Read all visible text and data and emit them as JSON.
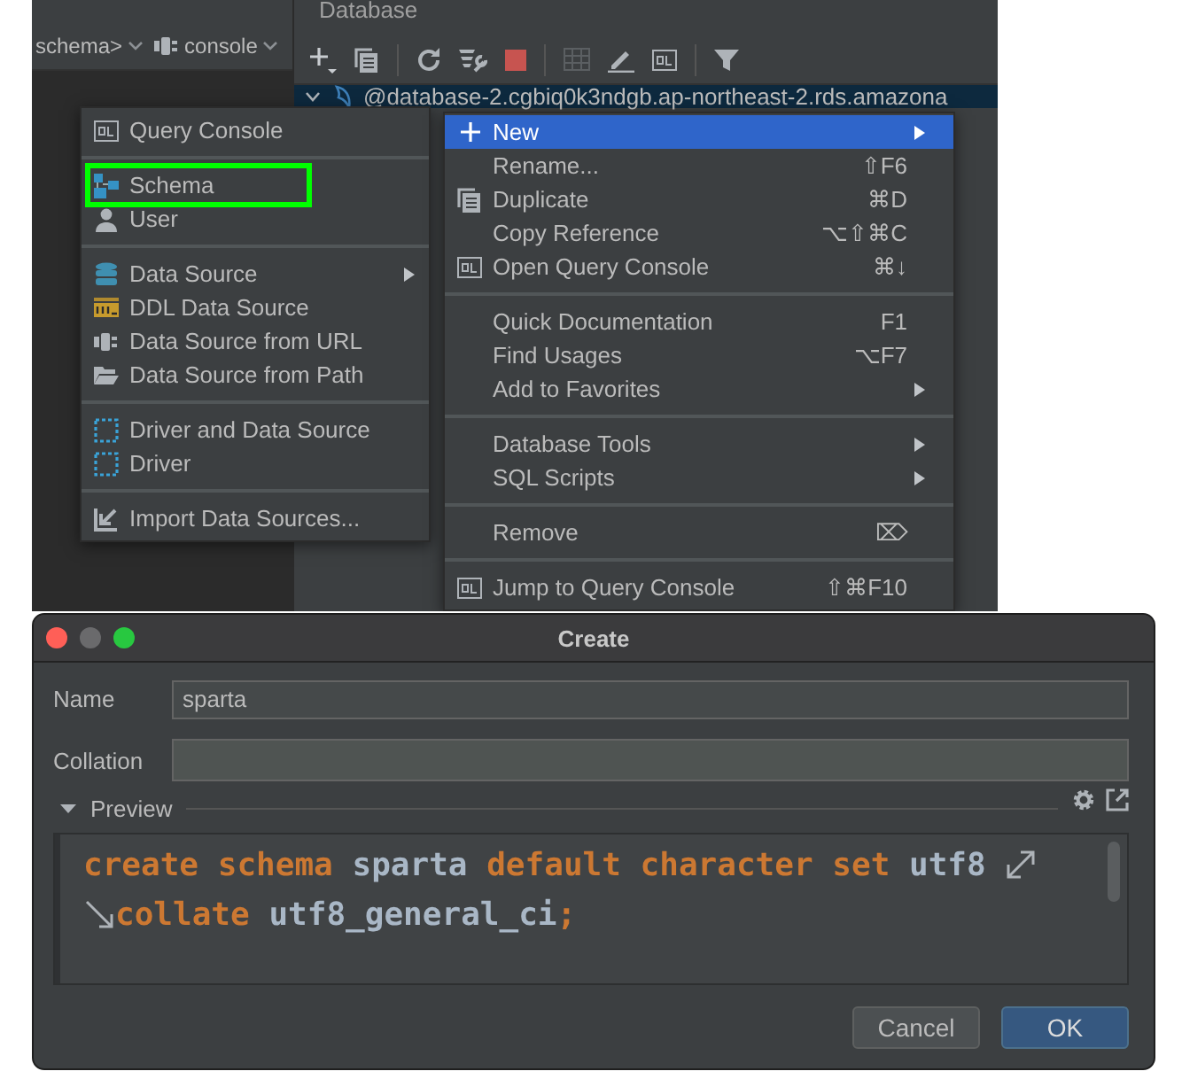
{
  "editor_toolbar": {
    "breadcrumb": "schema>",
    "console": "console"
  },
  "database_panel": {
    "title": "Database",
    "tree": [
      {
        "label": "@database-2.cgbiq0k3ndgb.ap-northeast-2.rds.amazona",
        "expanded": true,
        "selected": true
      }
    ]
  },
  "new_menu": {
    "items": [
      {
        "kind": "item",
        "label": "Query Console",
        "highlighted": false,
        "submenu": false
      },
      {
        "kind": "separator"
      },
      {
        "kind": "item",
        "label": "Schema",
        "highlighted": true,
        "submenu": false
      },
      {
        "kind": "item",
        "label": "User",
        "highlighted": false,
        "submenu": false
      },
      {
        "kind": "separator"
      },
      {
        "kind": "item",
        "label": "Data Source",
        "highlighted": false,
        "submenu": true
      },
      {
        "kind": "item",
        "label": "DDL Data Source",
        "highlighted": false,
        "submenu": false
      },
      {
        "kind": "item",
        "label": "Data Source from URL",
        "highlighted": false,
        "submenu": false
      },
      {
        "kind": "item",
        "label": "Data Source from Path",
        "highlighted": false,
        "submenu": false
      },
      {
        "kind": "separator"
      },
      {
        "kind": "item",
        "label": "Driver and Data Source",
        "highlighted": false,
        "submenu": false
      },
      {
        "kind": "item",
        "label": "Driver",
        "highlighted": false,
        "submenu": false
      },
      {
        "kind": "separator"
      },
      {
        "kind": "item",
        "label": "Import Data Sources...",
        "highlighted": false,
        "submenu": false
      }
    ]
  },
  "context_menu": {
    "items": [
      {
        "kind": "item",
        "label": "New",
        "selected": true,
        "submenu": true
      },
      {
        "kind": "item",
        "label": "Rename...",
        "selected": false,
        "shortcut": "⇧F6",
        "submenu": false
      },
      {
        "kind": "item",
        "label": "Duplicate",
        "selected": false,
        "shortcut": "⌘D",
        "submenu": false
      },
      {
        "kind": "item",
        "label": "Copy Reference",
        "selected": false,
        "shortcut": "⌥⇧⌘C",
        "submenu": false
      },
      {
        "kind": "item",
        "label": "Open Query Console",
        "selected": false,
        "shortcut": "⌘↓",
        "submenu": false
      },
      {
        "kind": "separator"
      },
      {
        "kind": "item",
        "label": "Quick Documentation",
        "selected": false,
        "shortcut": "F1",
        "submenu": false
      },
      {
        "kind": "item",
        "label": "Find Usages",
        "selected": false,
        "shortcut": "⌥F7",
        "submenu": false
      },
      {
        "kind": "item",
        "label": "Add to Favorites",
        "selected": false,
        "submenu": true
      },
      {
        "kind": "separator"
      },
      {
        "kind": "item",
        "label": "Database Tools",
        "selected": false,
        "submenu": true
      },
      {
        "kind": "item",
        "label": "SQL Scripts",
        "selected": false,
        "submenu": true
      },
      {
        "kind": "separator"
      },
      {
        "kind": "item",
        "label": "Remove",
        "selected": false,
        "shortcut": "⌦",
        "submenu": false
      },
      {
        "kind": "separator"
      },
      {
        "kind": "item",
        "label": "Jump to Query Console",
        "selected": false,
        "shortcut": "⇧⌘F10",
        "submenu": false
      }
    ]
  },
  "dialog": {
    "title": "Create",
    "fields": [
      {
        "label": "Name",
        "value": "sparta"
      },
      {
        "label": "Collation"
      }
    ],
    "preview": {
      "label": "Preview",
      "expanded": true,
      "lines": [
        {
          "wrapped": true,
          "continued": false,
          "tokens": [
            {
              "kind": "keyword",
              "text": "create schema"
            },
            {
              "kind": "plain",
              "text": " sparta "
            },
            {
              "kind": "keyword",
              "text": "default character set"
            },
            {
              "kind": "plain",
              "text": " utf8"
            }
          ]
        },
        {
          "wrapped": false,
          "continued": true,
          "tokens": [
            {
              "kind": "keyword",
              "text": "collate"
            },
            {
              "kind": "plain",
              "text": " utf8_general_ci"
            },
            {
              "kind": "keyword",
              "text": ";"
            }
          ]
        }
      ]
    },
    "buttons": [
      {
        "label": "Cancel",
        "default": false
      },
      {
        "label": "OK",
        "default": true
      }
    ]
  }
}
